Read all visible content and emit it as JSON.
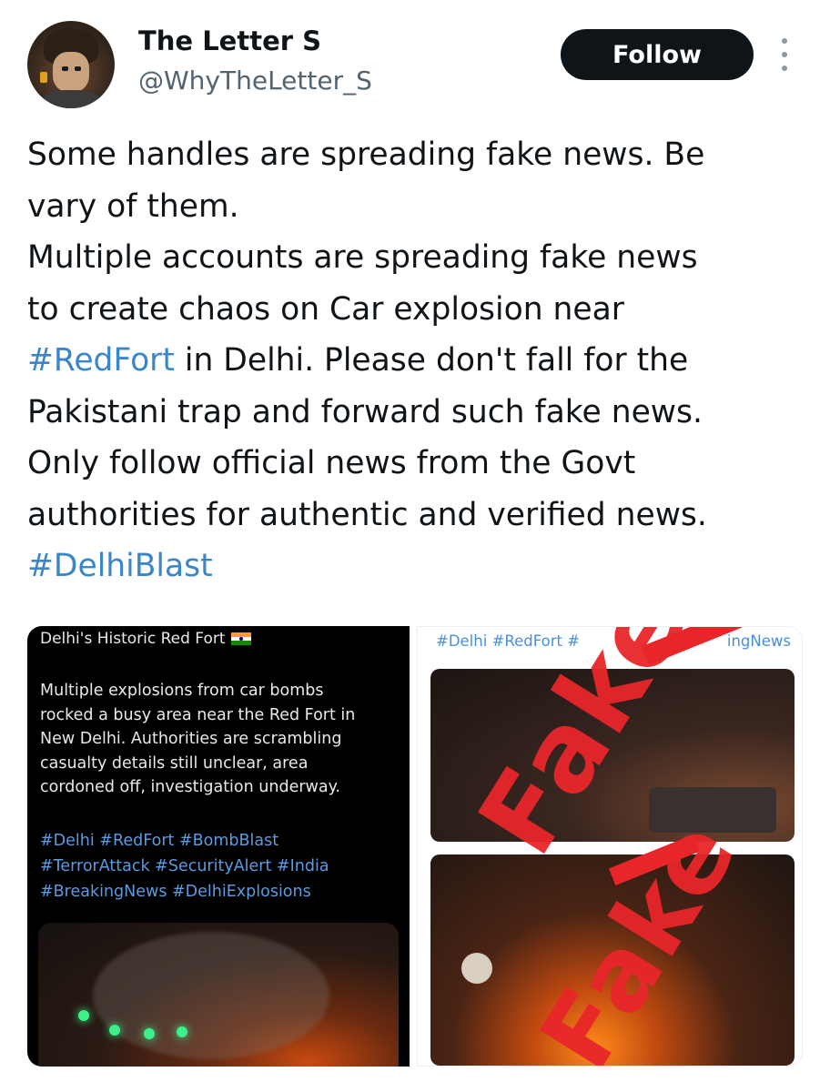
{
  "author": {
    "display_name": "The Letter S",
    "handle": "@WhyTheLetter_S",
    "avatar_icon": "cartoon-avatar-icon"
  },
  "actions": {
    "follow_label": "Follow",
    "more_icon": "more-vertical-icon"
  },
  "tweet": {
    "lines": [
      {
        "text": "Some handles are spreading fake news. Be"
      },
      {
        "text": "vary of them."
      },
      {
        "text": "Multiple accounts are spreading fake news"
      },
      {
        "text": "to create chaos on Car explosion near"
      },
      {
        "hashtag": "#RedFort",
        "text": " in Delhi. Please don't fall for the"
      },
      {
        "text": "Pakistani trap and forward such fake news."
      },
      {
        "text": "Only follow official news from the Govt"
      },
      {
        "text": "authorities for authentic and verified news."
      },
      {
        "hashtag": "#DelhiBlast",
        "text": ""
      }
    ],
    "link_color": "#3a86c8"
  },
  "media_left": {
    "title": "Delhi's Historic Red Fort",
    "flag_icon": "india-flag-icon",
    "body_lines": [
      "Multiple explosions from car bombs",
      "rocked a busy area near the Red Fort in",
      "New Delhi. Authorities are scrambling",
      "casualty details still unclear, area",
      "cordoned off, investigation underway."
    ],
    "tag_lines": [
      "#Delhi #RedFort #BombBlast",
      "#TerrorAttack #SecurityAlert #India",
      "#BreakingNews #DelhiExplosions"
    ]
  },
  "media_right": {
    "tag_line_left": "#Delhi #RedFort #",
    "tag_line_right": "ingNews",
    "stamp_text": "Fake",
    "stamp_color": "#e8262a"
  }
}
